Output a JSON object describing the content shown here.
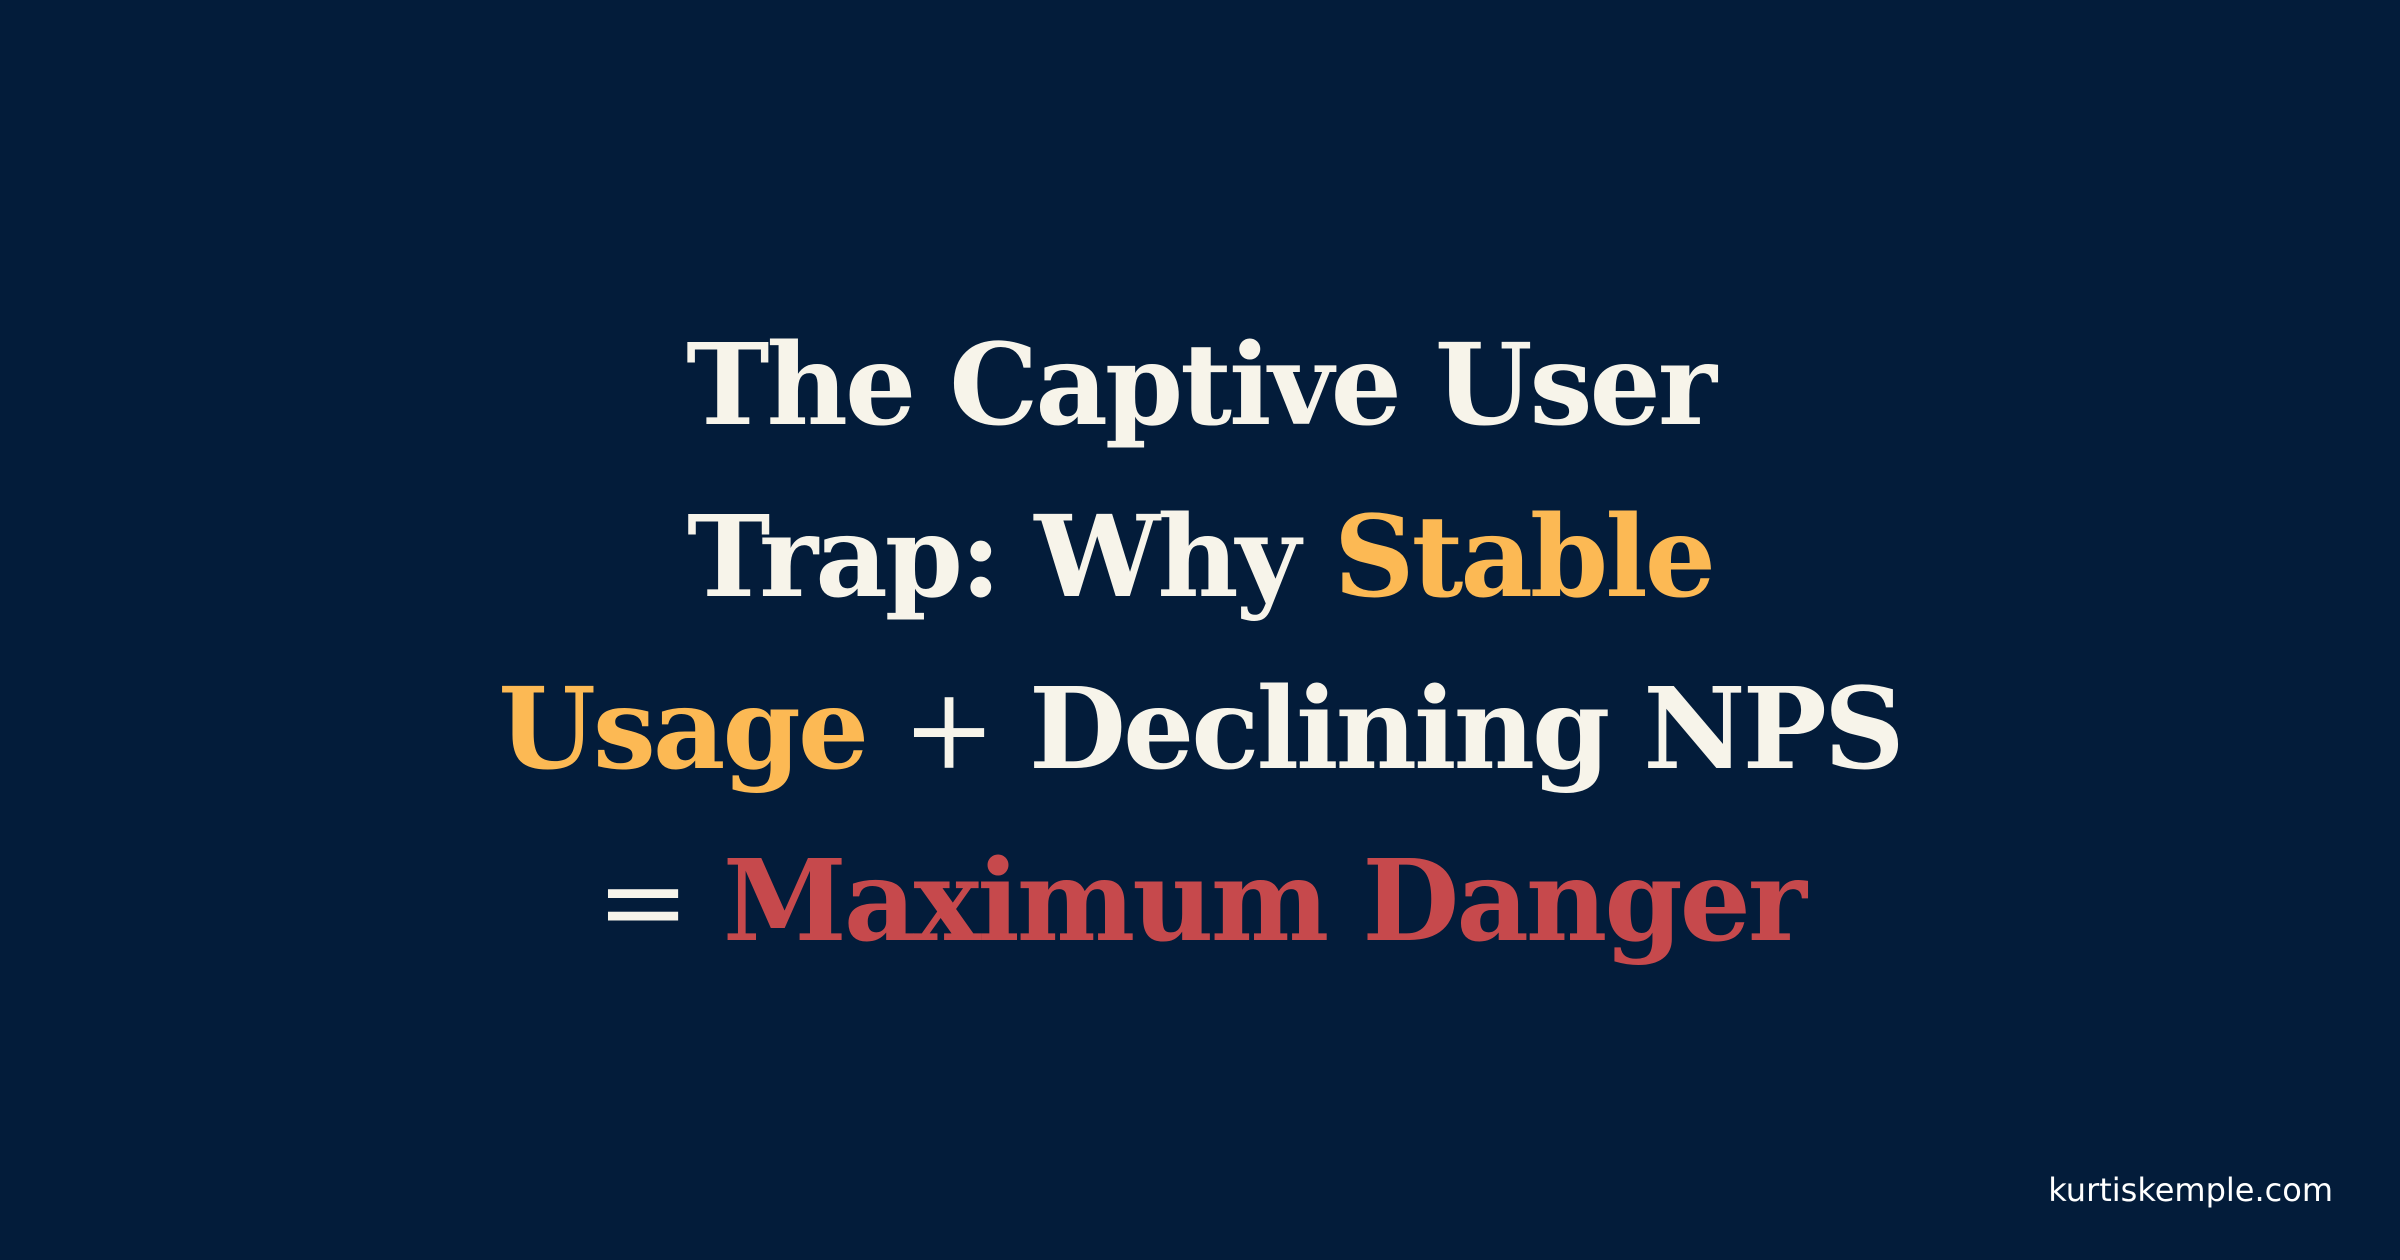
{
  "colors": {
    "background": "#031c3a",
    "text": "#f7f4ea",
    "highlight": "#fcb954",
    "danger": "#c6494c",
    "footer": "#ffffff"
  },
  "headline": {
    "line1": "The Captive User",
    "line2_prefix": "Trap: Why",
    "line2_highlight": "Stable",
    "line3_highlight": "Usage",
    "line3_operator": "+",
    "line3_suffix": "Declining NPS",
    "line4_operator": "=",
    "line4_danger": "Maximum Danger"
  },
  "footer": {
    "domain": "kurtiskemple.com"
  }
}
